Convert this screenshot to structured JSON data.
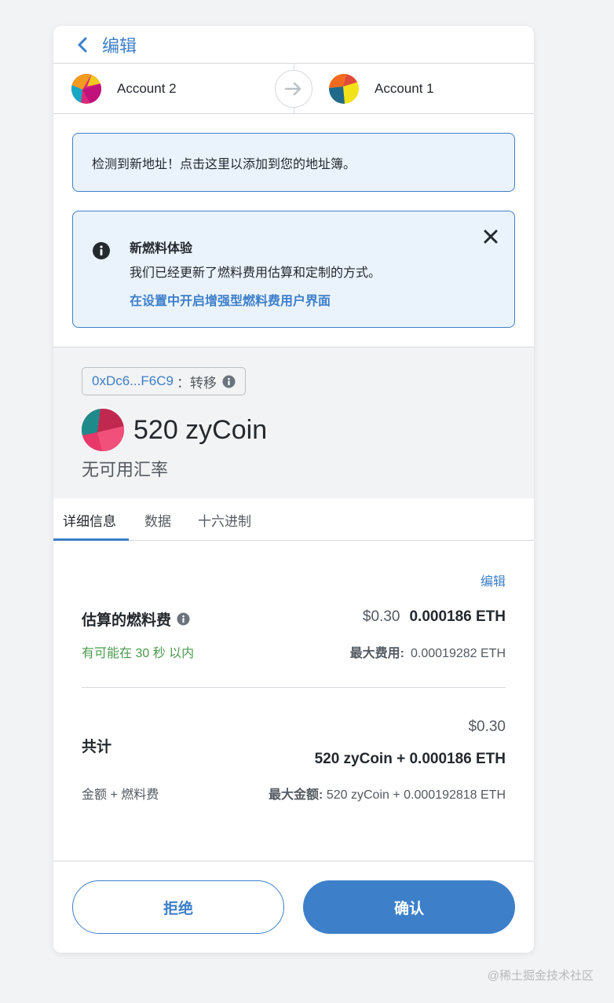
{
  "header": {
    "back_icon": "chevron-left-icon",
    "edit_label": "编辑"
  },
  "accounts": {
    "from": "Account 2",
    "to": "Account 1",
    "arrow_icon": "arrow-right-icon"
  },
  "new_address_notice": "检测到新地址！点击这里以添加到您的地址簿。",
  "gas_notice": {
    "title": "新燃料体验",
    "body": "我们已经更新了燃料费用估算和定制的方式。",
    "link": "在设置中开启增强型燃料费用户界面",
    "close_icon": "close-icon"
  },
  "summary": {
    "contract_address": "0xDc6...F6C9",
    "action": "：转移",
    "amount": "520 zyCoin",
    "rate": "无可用汇率"
  },
  "tabs": [
    {
      "label": "详细信息",
      "active": true
    },
    {
      "label": "数据",
      "active": false
    },
    {
      "label": "十六进制",
      "active": false
    }
  ],
  "details": {
    "edit_label": "编辑",
    "gas_label": "估算的燃料费",
    "gas_fiat": "$0.30",
    "gas_eth": "0.000186 ETH",
    "gas_time": "有可能在 30 秒 以内",
    "max_fee_label": "最大费用:",
    "max_fee_value": "0.00019282 ETH",
    "total_label": "共计",
    "total_fiat": "$0.30",
    "total_eth": "520 zyCoin + 0.000186 ETH",
    "amount_fee_label": "金额 + 燃料费",
    "max_amount_label": "最大金额:",
    "max_amount_value": "520 zyCoin + 0.000192818 ETH"
  },
  "footer": {
    "reject_label": "拒绝",
    "confirm_label": "确认"
  },
  "watermark": "@稀土掘金技术社区",
  "colors": {
    "accent": "#3d7fc9",
    "success": "#4a9a4d",
    "notice_bg": "#eaf3fc"
  }
}
